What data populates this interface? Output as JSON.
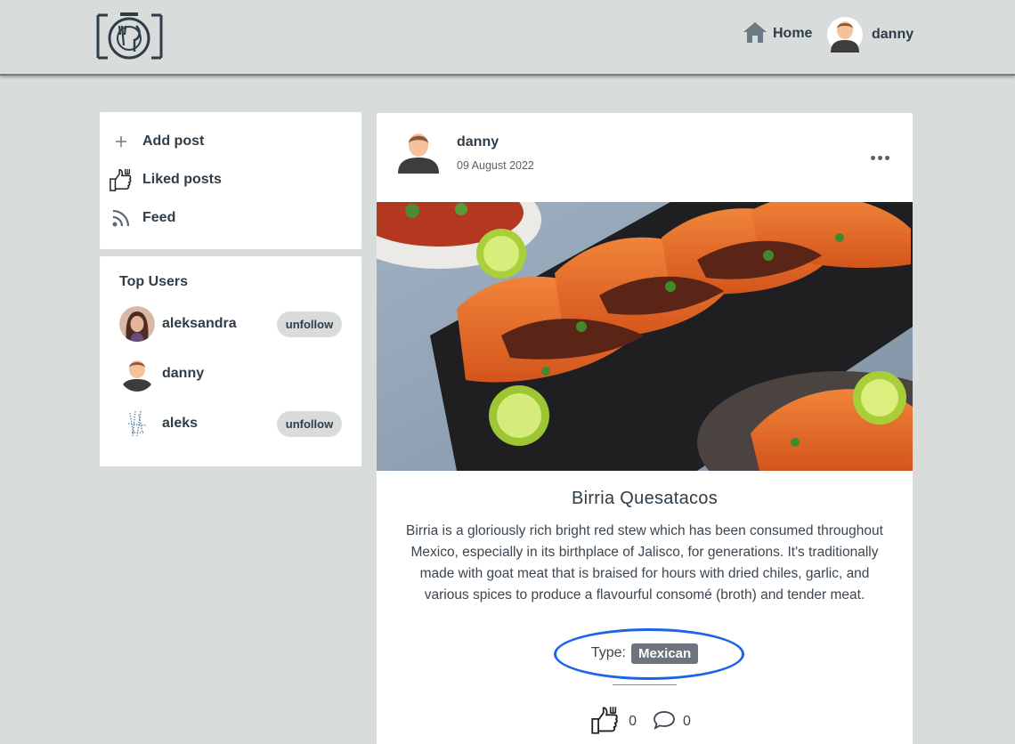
{
  "header": {
    "nav_home": "Home",
    "nav_user": "danny"
  },
  "sidebar": {
    "menu": [
      {
        "label": "Add post",
        "icon": "plus-icon"
      },
      {
        "label": "Liked posts",
        "icon": "thumbs-up-fork-icon"
      },
      {
        "label": "Feed",
        "icon": "rss-feed-icon"
      }
    ],
    "top_users_title": "Top Users",
    "top_users": [
      {
        "name": "aleksandra",
        "button": "unfollow"
      },
      {
        "name": "danny",
        "button": ""
      },
      {
        "name": "aleks",
        "button": "unfollow"
      }
    ]
  },
  "post": {
    "author": "danny",
    "date": "09 August 2022",
    "title": "Birria Quesatacos",
    "description": "Birria is a gloriously rich bright red stew which has been consumed throughout Mexico, especially in its birthplace of Jalisco, for generations. It's traditionally made with goat meat that is braised for hours with dried chiles, garlic, and various spices to produce a flavourful consomé (broth) and tender meat.",
    "type_label": "Type:",
    "type_value": "Mexican",
    "likes": "0",
    "comments": "0"
  },
  "colors": {
    "background": "#d8dcdb",
    "text": "#2f3d48",
    "badge": "#6c757d",
    "highlight": "#1b66e8",
    "divider": "#e06a6a"
  }
}
